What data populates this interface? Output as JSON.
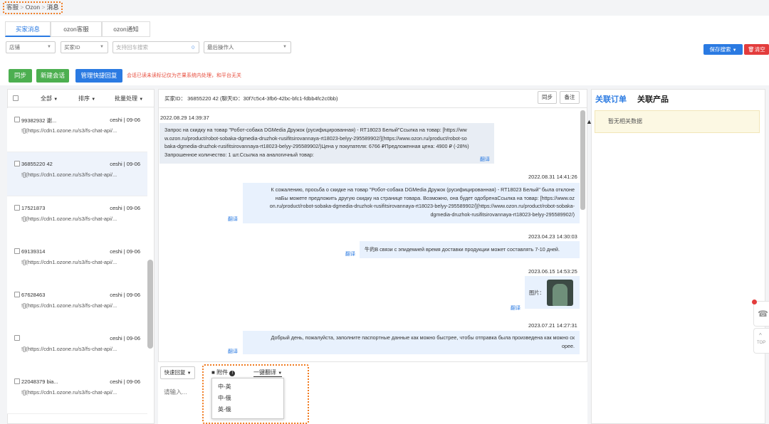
{
  "breadcrumb": {
    "a": "客服",
    "sep": ">",
    "b": "Ozon",
    "c": "消息"
  },
  "tabs": [
    "买家消息",
    "ozon客服",
    "ozon通知"
  ],
  "filters": {
    "shop": "店铺",
    "buyer": "买家ID",
    "search_placeholder": "支持回车搜索",
    "last_operator": "最后操作人"
  },
  "actions": {
    "save_search": "保存搜索",
    "clear": "清空"
  },
  "toolbar": {
    "sync": "同步",
    "new_chat": "新建会话",
    "quick_reply": "管理快捷回复",
    "warning": "会话已读未读标记仅为芒果系统内处理，和平台无关"
  },
  "list_header": {
    "all": "全部",
    "sort": "排序",
    "batch": "批量处理"
  },
  "conversations": [
    {
      "name": "99382932 谢...",
      "meta": "ceshi | 09-06",
      "preview": "![](https://cdn1.ozone.ru/s3/fs-chat-api/..."
    },
    {
      "name": "36855220 42",
      "meta": "ceshi | 09-06",
      "preview": "![](https://cdn1.ozone.ru/s3/fs-chat-api/..."
    },
    {
      "name": "17521873",
      "meta": "ceshi | 09-06",
      "preview": "![](https://cdn1.ozone.ru/s3/fs-chat-api/..."
    },
    {
      "name": "69139314",
      "meta": "ceshi | 09-06",
      "preview": "![](https://cdn1.ozone.ru/s3/fs-chat-api/..."
    },
    {
      "name": "67628463",
      "meta": "ceshi | 09-06",
      "preview": "![](https://cdn1.ozone.ru/s3/fs-chat-api/..."
    },
    {
      "name": "",
      "meta": "ceshi | 09-06",
      "preview": "![](https://cdn1.ozone.ru/s3/fs-chat-api/..."
    },
    {
      "name": "22048379 bia...",
      "meta": "ceshi | 09-06",
      "preview": "![](https://cdn1.ozone.ru/s3/fs-chat-api/..."
    }
  ],
  "chat": {
    "header": "买家ID： 36855220 42 (聊天ID：30f7c5c4-3fb6-42bc-bfc1-fdbb4fc2c0bb)",
    "sync": "同步",
    "note": "备注",
    "m1_time": "2022.08.29 14:39:37",
    "m1": [
      "Запрос на скидку на товар \"Робот-собака DGMedia Дружок (русифицированная) - RT18023 Белый\"Ссылка на товар: [https://ww",
      "w.ozon.ru/product/robot-sobaka-dgmedia-druzhok-rusifitsirovannaya-rt18023-belyy-295589902/](https://www.ozon.ru/product/robot-so",
      "baka-dgmedia-druzhok-rusifitsirovannaya-rt18023-belyy-295589902/)Цена у покупателя: 6766 ₽Предложенная цена: 4900 ₽ (-28%)",
      "Запрошенное количество: 1 шт.Ссылка на аналогичный товар:"
    ],
    "m2_time": "2022.08.31 14:41:26",
    "m2": [
      "К сожалению, просьба о скидке на товар \"Робот-собака DGMedia Дружок (русифицированная) - RT18023 Белый\" была отклоне",
      "наБы можете предложить другую скидку на странице товара. Возможно, она будет одобренаСсылка на товар: [https://www.oz",
      "on.ru/product/robot-sobaka-dgmedia-druzhok-rusifitsirovannaya-rt18023-belyy-295589902/](https://www.ozon.ru/product/robot-sobaka-",
      "dgmedia-druzhok-rusifitsirovannaya-rt18023-belyy-295589902/)"
    ],
    "m3_time": "2023.04.23 14:30:03",
    "m3": "牛的В связи с эпидемией время доставки продукции может составлять 7-10 дней.",
    "m4_time": "2023.06.15 14:53:25",
    "m4": "图片：",
    "m5_time": "2023.07.21 14:27:31",
    "m5": [
      "Добрый день, пожалуйста, заполните паспортные данные как можно быстрее, чтобы отправка была произведена как можно ск",
      "орее."
    ],
    "translate": "翻译"
  },
  "composer": {
    "quick": "快速回复",
    "attach": "附件",
    "translate": "一键翻译",
    "placeholder": "请输入..."
  },
  "translate_options": [
    "中-英",
    "中-俄",
    "英-俄"
  ],
  "right": {
    "tab1": "关联订单",
    "tab2": "关联产品",
    "nodata": "暂无相关数据"
  },
  "float": {
    "top": "TOP"
  }
}
